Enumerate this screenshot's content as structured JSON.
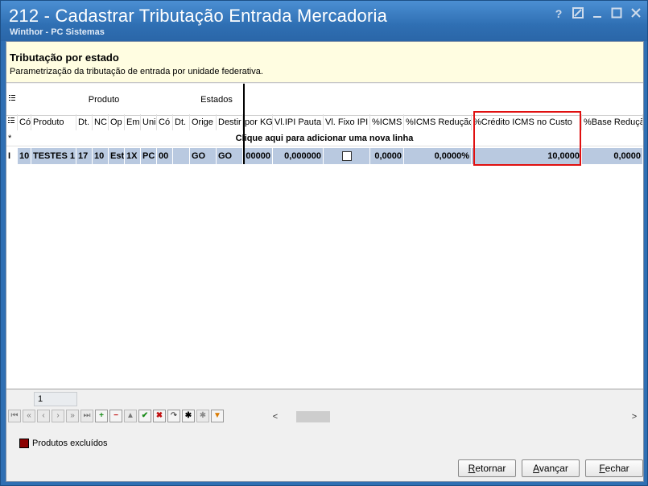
{
  "window": {
    "title": "212 - Cadastrar Tributação Entrada Mercadoria",
    "subtitle": "Winthor - PC Sistemas",
    "controls": [
      "help-icon",
      "restore-icon",
      "minimize-icon",
      "maximize-icon",
      "close-icon"
    ]
  },
  "header_panel": {
    "title": "Tributação por estado",
    "description": "Parametrização da tributação de entrada por unidade federativa."
  },
  "grid": {
    "band_groups": {
      "produto": "Produto",
      "estados": "Estados"
    },
    "columns": [
      "Có",
      "Produto",
      "Dt.",
      "NC",
      "Op",
      "Em",
      "Uni",
      "Có",
      "Dt.",
      "Orige",
      "Destir",
      "por KG",
      "Vl.IPI Pauta",
      "Vl. Fixo IPI",
      "%ICMS",
      "%ICMS Redução",
      "%Crédito ICMS no Custo",
      "%Base Redução"
    ],
    "new_row_marker": "*",
    "new_row_text": "Clique aqui para adicionar uma nova linha",
    "rows": [
      {
        "indicator": "I",
        "cells": [
          "10",
          "TESTES 1",
          "17",
          "10",
          "Est",
          "1X",
          "PC",
          "00",
          "",
          "GO",
          "GO",
          "00000",
          "0,000000",
          "",
          "0,0000",
          "0,0000%",
          "10,0000",
          "0,0000"
        ]
      }
    ],
    "highlight_column": "%Crédito ICMS no Custo",
    "highlight_color": "#e01010",
    "selected_row_color": "#b9c9e0"
  },
  "footer": {
    "record_count": "1"
  },
  "navigator": {
    "buttons": [
      "first-icon",
      "prev-page-icon",
      "prev-icon",
      "next-icon",
      "next-page-icon",
      "last-icon",
      "add-icon",
      "delete-icon",
      "edit-icon",
      "post-icon",
      "cancel-icon",
      "refresh-icon",
      "asterisk-icon",
      "clear-icon",
      "filter-icon"
    ],
    "scroll_left": "<",
    "scroll_right": ">"
  },
  "legend": {
    "label": "Produtos excluídos",
    "color": "#8b0000"
  },
  "buttons": {
    "back": "Retornar",
    "next": "Avançar",
    "close": "Fechar"
  }
}
